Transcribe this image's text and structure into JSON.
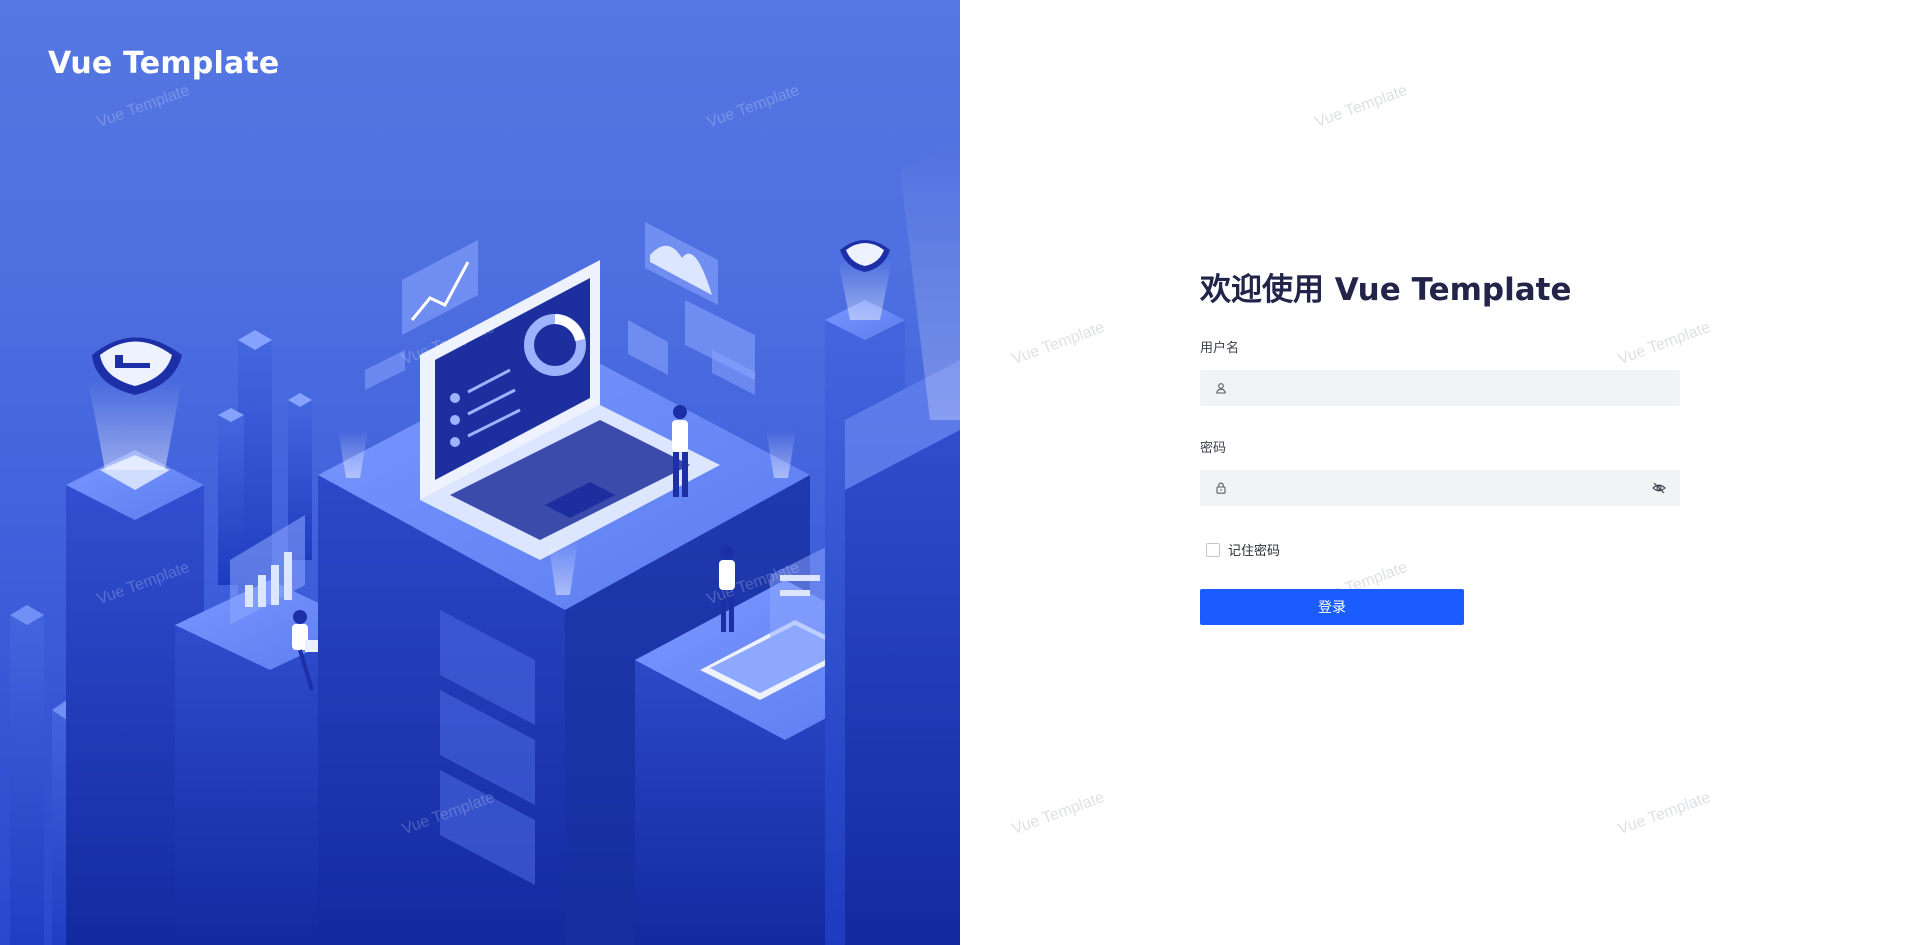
{
  "brand": {
    "title": "Vue Template"
  },
  "login": {
    "welcome": "欢迎使用 Vue Template",
    "username_label": "用户名",
    "username_value": "",
    "password_label": "密码",
    "password_value": "",
    "remember_label": "记住密码",
    "remember_checked": false,
    "submit_label": "登录"
  },
  "watermark": {
    "text": "Vue Template"
  },
  "icons": {
    "username": "user-icon",
    "password": "lock-icon",
    "toggle_password": "eye-off-icon"
  },
  "colors": {
    "left_bg": "#4d6fe0",
    "primary_button": "#1b5cff",
    "title_text": "#23244a",
    "input_bg": "#f2f3f5"
  }
}
